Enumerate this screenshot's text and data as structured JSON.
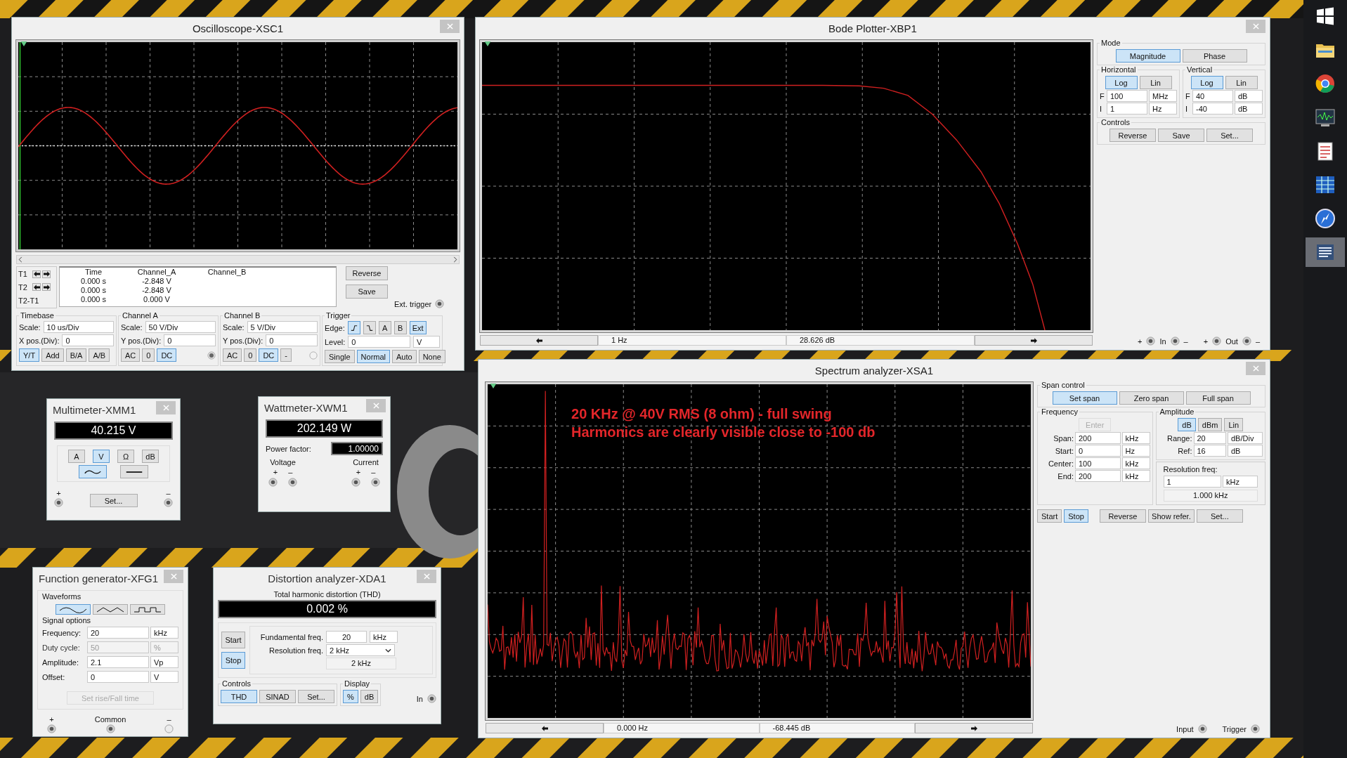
{
  "taskbar": {
    "items": [
      {
        "selected": false
      },
      {
        "selected": false
      },
      {
        "selected": false
      },
      {
        "selected": false
      },
      {
        "selected": false
      },
      {
        "selected": false
      },
      {
        "selected": false
      },
      {
        "selected": true
      }
    ]
  },
  "windows": [
    {
      "kind": "oscilloscope",
      "title": "Oscilloscope-XSC1",
      "cursors": {
        "labels": [
          "T1",
          "T2",
          "T2-T1"
        ],
        "columns": [
          "Time",
          "Channel_A",
          "Channel_B"
        ],
        "rows": [
          [
            "0.000 s",
            "-2.848 V"
          ],
          [
            "0.000 s",
            "-2.848 V"
          ],
          [
            "0.000 s",
            "0.000 V"
          ]
        ]
      },
      "buttons": [
        {
          "label": "Reverse"
        },
        {
          "label": "Save"
        }
      ],
      "ext_trigger": "Ext. trigger",
      "groups": [
        {
          "title": "Timebase",
          "fields": [
            {
              "label": "Scale:",
              "value": "10 us/Div"
            },
            {
              "label": "X pos.(Div):",
              "value": "0"
            }
          ],
          "buttons": [
            {
              "label": "Y/T",
              "selected": true
            },
            {
              "label": "Add",
              "selected": false
            },
            {
              "label": "B/A",
              "selected": false
            },
            {
              "label": "A/B",
              "selected": false
            }
          ]
        },
        {
          "title": "Channel A",
          "fields": [
            {
              "label": "Scale:",
              "value": "50  V/Div"
            },
            {
              "label": "Y pos.(Div):",
              "value": "0"
            }
          ],
          "buttons": [
            {
              "label": "AC",
              "selected": false
            },
            {
              "label": "0",
              "selected": false
            },
            {
              "label": "DC",
              "selected": true
            }
          ],
          "connected": true
        },
        {
          "title": "Channel B",
          "fields": [
            {
              "label": "Scale:",
              "value": "5  V/Div"
            },
            {
              "label": "Y pos.(Div):",
              "value": "0"
            }
          ],
          "buttons": [
            {
              "label": "AC",
              "selected": false
            },
            {
              "label": "0",
              "selected": false
            },
            {
              "label": "DC",
              "selected": true
            },
            {
              "label": "-",
              "selected": false
            }
          ],
          "connected": false
        }
      ],
      "trigger": {
        "title": "Trigger",
        "edge_label": "Edge:",
        "edge_buttons": [
          {
            "kind": "rising",
            "selected": true
          },
          {
            "kind": "falling",
            "selected": false
          },
          {
            "kind": "text",
            "label": "A",
            "selected": false
          },
          {
            "kind": "text",
            "label": "B",
            "selected": false
          },
          {
            "kind": "text",
            "label": "Ext",
            "selected": true
          }
        ],
        "level_label": "Level:",
        "level": "0",
        "level_unit": "V",
        "buttons": [
          {
            "label": "Single",
            "selected": false
          },
          {
            "label": "Normal",
            "selected": true
          },
          {
            "label": "Auto",
            "selected": false
          },
          {
            "label": "None",
            "selected": false
          }
        ]
      }
    },
    {
      "kind": "bode",
      "title": "Bode Plotter-XBP1",
      "readouts": [
        "1 Hz",
        "28.626 dB"
      ],
      "mode": {
        "title": "Mode",
        "buttons": [
          {
            "label": "Magnitude",
            "selected": true
          },
          {
            "label": "Phase",
            "selected": false
          }
        ]
      },
      "axes": [
        {
          "title": "Horizontal",
          "buttons": [
            {
              "label": "Log",
              "selected": true
            },
            {
              "label": "Lin",
              "selected": false
            }
          ],
          "rows": [
            {
              "label": "F",
              "value": "100",
              "unit": "MHz"
            },
            {
              "label": "I",
              "value": "1",
              "unit": "Hz"
            }
          ]
        },
        {
          "title": "Vertical",
          "buttons": [
            {
              "label": "Log",
              "selected": true
            },
            {
              "label": "Lin",
              "selected": false
            }
          ],
          "rows": [
            {
              "label": "F",
              "value": "40",
              "unit": "dB"
            },
            {
              "label": "I",
              "value": "-40",
              "unit": "dB"
            }
          ]
        }
      ],
      "controls": {
        "title": "Controls",
        "buttons": [
          {
            "label": "Reverse"
          },
          {
            "label": "Save"
          },
          {
            "label": "Set..."
          }
        ]
      },
      "terminals": [
        {
          "plus": "+",
          "label": "In",
          "minus": "–"
        },
        {
          "plus": "+",
          "label": "Out",
          "minus": "–"
        }
      ]
    },
    {
      "kind": "multimeter",
      "title": "Multimeter-XMM1",
      "display": "40.215 V",
      "modes": [
        {
          "label": "A",
          "selected": false
        },
        {
          "label": "V",
          "selected": true
        },
        {
          "label": "Ω",
          "selected": false
        },
        {
          "label": "dB",
          "selected": false
        }
      ],
      "signal": [
        {
          "kind": "ac",
          "selected": true
        },
        {
          "kind": "dc",
          "selected": false
        }
      ],
      "set": "Set...",
      "plus": "+",
      "minus": "–"
    },
    {
      "kind": "wattmeter",
      "title": "Wattmeter-XWM1",
      "display": "202.149 W",
      "pf_label": "Power factor:",
      "pf": "1.00000",
      "groups": [
        {
          "label": "Voltage",
          "plus": "+",
          "minus": "–"
        },
        {
          "label": "Current",
          "plus": "+",
          "minus": "–"
        }
      ]
    },
    {
      "kind": "spectrum",
      "title": "Spectrum analyzer-XSA1",
      "annotation": [
        "20 KHz @ 40V RMS (8 ohm) - full swing",
        "Harmonics are clearly visible close to -100 db"
      ],
      "readouts": [
        "0.000 Hz",
        "-68.445 dB"
      ],
      "span": {
        "title": "Span control",
        "buttons": [
          {
            "label": "Set span",
            "selected": true
          },
          {
            "label": "Zero span",
            "selected": false
          },
          {
            "label": "Full span",
            "selected": false
          }
        ]
      },
      "frequency": {
        "title": "Frequency",
        "enter": {
          "label": "Enter",
          "disabled": true
        },
        "rows": [
          {
            "label": "Span:",
            "value": "200",
            "unit": "kHz"
          },
          {
            "label": "Start:",
            "value": "0",
            "unit": "Hz"
          },
          {
            "label": "Center:",
            "value": "100",
            "unit": "kHz"
          },
          {
            "label": "End:",
            "value": "200",
            "unit": "kHz"
          }
        ]
      },
      "amplitude": {
        "title": "Amplitude",
        "buttons": [
          {
            "label": "dB",
            "selected": true
          },
          {
            "label": "dBm",
            "selected": false
          },
          {
            "label": "Lin",
            "selected": false
          }
        ],
        "rows": [
          {
            "label": "Range:",
            "value": "20",
            "unit": "dB/Div"
          },
          {
            "label": "Ref:",
            "value": "16",
            "unit": "dB"
          }
        ]
      },
      "resolution": {
        "title": "Resolution freq:",
        "value": "1",
        "unit": "kHz",
        "reading": "1.000 kHz"
      },
      "run_buttons": [
        {
          "label": "Start",
          "selected": false
        },
        {
          "label": "Stop",
          "selected": true
        }
      ],
      "buttons": [
        {
          "label": "Reverse"
        },
        {
          "label": "Show refer."
        },
        {
          "label": "Set..."
        }
      ],
      "terminals": [
        "Input",
        "Trigger"
      ]
    },
    {
      "kind": "function_generator",
      "title": "Function generator-XFG1",
      "waveforms_title": "Waveforms",
      "waveforms": [
        {
          "kind": "sine",
          "selected": true
        },
        {
          "kind": "triangle",
          "selected": false
        },
        {
          "kind": "square",
          "selected": false
        }
      ],
      "options_title": "Signal options",
      "rows": [
        {
          "label": "Frequency:",
          "value": "20",
          "unit": "kHz",
          "disabled": false
        },
        {
          "label": "Duty cycle:",
          "value": "50",
          "unit": "%",
          "disabled": true
        },
        {
          "label": "Amplitude:",
          "value": "2.1",
          "unit": "Vp",
          "disabled": false
        },
        {
          "label": "Offset:",
          "value": "0",
          "unit": "V",
          "disabled": false
        }
      ],
      "rise_fall": "Set rise/Fall time",
      "terminals": [
        {
          "label": "+",
          "connected": true
        },
        {
          "label": "Common",
          "connected": true
        },
        {
          "label": "–",
          "connected": false
        }
      ]
    },
    {
      "kind": "distortion",
      "title": "Distortion analyzer-XDA1",
      "thd_title": "Total harmonic distortion (THD)",
      "display": "0.002 %",
      "run_buttons": [
        {
          "label": "Start",
          "selected": false
        },
        {
          "label": "Stop",
          "selected": true
        }
      ],
      "fundamental": {
        "label": "Fundamental freq.",
        "value": "20",
        "unit": "kHz"
      },
      "resolution": {
        "label": "Resolution freq.",
        "value": "2 kHz",
        "reading": "2 kHz"
      },
      "controls": {
        "title": "Controls",
        "buttons": [
          {
            "label": "THD",
            "selected": true
          },
          {
            "label": "SINAD",
            "selected": false
          },
          {
            "label": "Set...",
            "selected": false
          }
        ]
      },
      "display_mode": {
        "title": "Display",
        "buttons": [
          {
            "label": "%",
            "selected": true
          },
          {
            "label": "dB",
            "selected": false
          }
        ]
      },
      "input": "In"
    }
  ]
}
